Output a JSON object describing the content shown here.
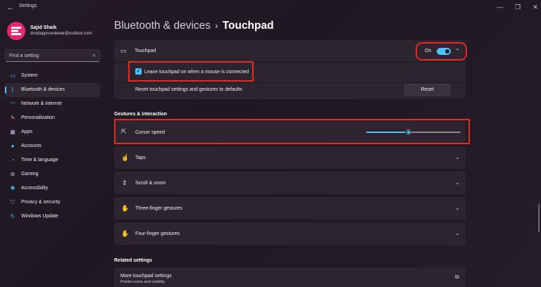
{
  "window": {
    "title": "Settings"
  },
  "user": {
    "name": "Sajid Shaik",
    "email": "droidappsreviewer@outlook.com"
  },
  "search": {
    "placeholder": "Find a setting"
  },
  "sidebar": {
    "items": [
      {
        "label": "System",
        "icon": "monitor-icon",
        "color": "#4cc2ff"
      },
      {
        "label": "Bluetooth & devices",
        "icon": "bluetooth-icon",
        "color": "#4cc2ff",
        "active": true
      },
      {
        "label": "Network & internet",
        "icon": "wifi-icon",
        "color": "#4cc2ff"
      },
      {
        "label": "Personalization",
        "icon": "brush-icon",
        "color": "#e8a070"
      },
      {
        "label": "Apps",
        "icon": "apps-icon",
        "color": "#b0b0d0"
      },
      {
        "label": "Accounts",
        "icon": "person-icon",
        "color": "#4cc2ff"
      },
      {
        "label": "Time & language",
        "icon": "globe-clock-icon",
        "color": "#4cc2ff"
      },
      {
        "label": "Gaming",
        "icon": "controller-icon",
        "color": "#c0c0c0"
      },
      {
        "label": "Accessibility",
        "icon": "accessibility-icon",
        "color": "#4cc2ff"
      },
      {
        "label": "Privacy & security",
        "icon": "shield-icon",
        "color": "#a0a0a0"
      },
      {
        "label": "Windows Update",
        "icon": "update-icon",
        "color": "#4cc2ff"
      }
    ]
  },
  "breadcrumb": {
    "parent": "Bluetooth & devices",
    "separator": "›",
    "current": "Touchpad"
  },
  "touchpad": {
    "label": "Touchpad",
    "toggle_state": "On",
    "enabled": true,
    "leave_on_label": "Leave touchpad on when a mouse is connected",
    "leave_on_checked": true,
    "reset_label": "Reset touchpad settings and gestures to defaults",
    "reset_button": "Reset"
  },
  "gestures": {
    "section_title": "Gestures & interaction",
    "cursor_speed_label": "Cursor speed",
    "cursor_speed_value": 0.45,
    "items": [
      {
        "label": "Taps",
        "icon": "tap-icon"
      },
      {
        "label": "Scroll & zoom",
        "icon": "scroll-icon"
      },
      {
        "label": "Three-finger gestures",
        "icon": "three-finger-icon"
      },
      {
        "label": "Four-finger gestures",
        "icon": "four-finger-icon"
      }
    ]
  },
  "related": {
    "section_title": "Related settings",
    "more_label": "More touchpad settings",
    "more_sub": "Pointer icons and visibility"
  },
  "colors": {
    "accent": "#4cc2ff",
    "highlight": "#e62a1f",
    "avatar": "#e7266b"
  }
}
